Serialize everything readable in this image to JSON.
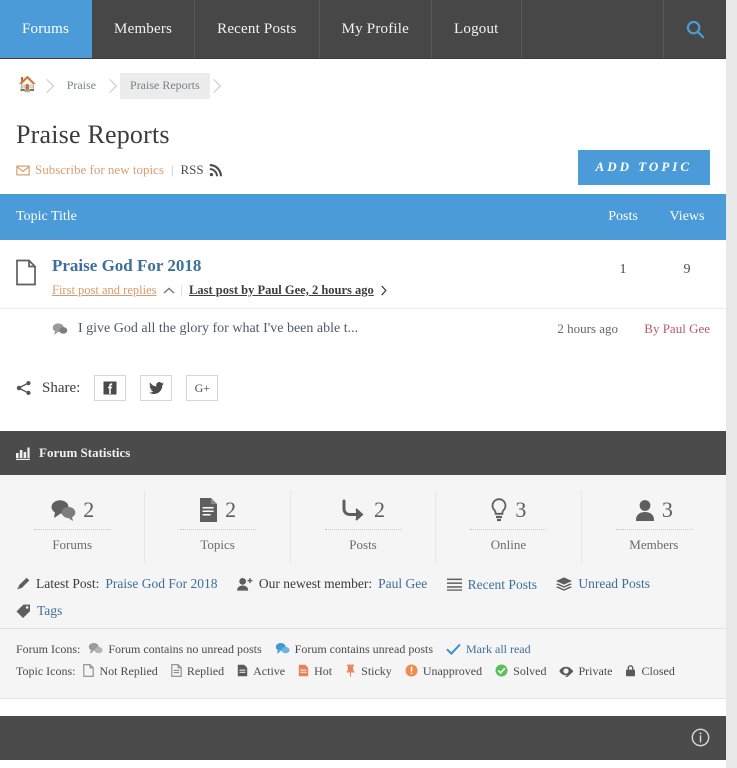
{
  "nav": {
    "items": [
      {
        "label": "Forums",
        "active": true
      },
      {
        "label": "Members",
        "active": false
      },
      {
        "label": "Recent Posts",
        "active": false
      },
      {
        "label": "My Profile",
        "active": false
      },
      {
        "label": "Logout",
        "active": false
      }
    ],
    "search_icon": "search-icon",
    "active_color": "#4a9bd8",
    "bar_color": "#474747"
  },
  "breadcrumb": {
    "home_icon": "home-icon",
    "items": [
      {
        "label": "Praise",
        "current": false
      },
      {
        "label": "Praise Reports",
        "current": true
      }
    ]
  },
  "header": {
    "title": "Praise Reports",
    "subscribe_label": "Subscribe for new topics",
    "separator": "|",
    "rss_label": "RSS",
    "add_topic_label": "ADD TOPIC"
  },
  "topic_table": {
    "columns": {
      "title": "Topic Title",
      "posts": "Posts",
      "views": "Views"
    },
    "rows": [
      {
        "icon": "document-icon",
        "title": "Praise God For 2018",
        "first_post_label": "First post and replies",
        "last_post_label": "Last post by Paul Gee, 2 hours ago",
        "posts": "1",
        "views": "9"
      }
    ],
    "replies": [
      {
        "icon": "comment-icon",
        "text": "I give God all the glory for what I've been able t...",
        "time": "2 hours ago",
        "author": "By Paul Gee"
      }
    ]
  },
  "share": {
    "label": "Share:",
    "icon": "share-icon",
    "buttons": [
      {
        "name": "facebook-icon",
        "label": "f"
      },
      {
        "name": "twitter-icon",
        "label": "t"
      },
      {
        "name": "google-plus-icon",
        "label": "G+"
      }
    ]
  },
  "statistics": {
    "heading": "Forum Statistics",
    "heading_icon": "chart-bar-icon",
    "cells": [
      {
        "icon": "comments-icon",
        "value": "2",
        "label": "Forums"
      },
      {
        "icon": "file-text-icon",
        "value": "2",
        "label": "Topics"
      },
      {
        "icon": "reply-arrow-icon",
        "value": "2",
        "label": "Posts"
      },
      {
        "icon": "lightbulb-icon",
        "value": "3",
        "label": "Online"
      },
      {
        "icon": "user-icon",
        "value": "3",
        "label": "Members"
      }
    ],
    "links": [
      {
        "icon": "pencil-icon",
        "prefix": "Latest Post:",
        "link": "Praise God For 2018"
      },
      {
        "icon": "user-plus-icon",
        "prefix": "Our newest member:",
        "link": "Paul Gee"
      },
      {
        "icon": "list-icon",
        "prefix": "",
        "link": "Recent Posts"
      },
      {
        "icon": "layers-icon",
        "prefix": "",
        "link": "Unread Posts"
      },
      {
        "icon": "tag-icon",
        "prefix": "",
        "link": "Tags"
      }
    ]
  },
  "legend": {
    "forum_icons_label": "Forum Icons:",
    "forum_items": [
      {
        "icon": "comments-gray-icon",
        "label": "Forum contains no unread posts",
        "color": "#9a9a9a"
      },
      {
        "icon": "comments-blue-icon",
        "label": "Forum contains unread posts",
        "color": "#3f9ad6"
      }
    ],
    "mark_all_read": "Mark all read",
    "mark_all_read_icon": "check-icon",
    "topic_icons_label": "Topic Icons:",
    "topic_items": [
      {
        "icon": "file-blank-icon",
        "label": "Not Replied",
        "color": "#8b8b8b"
      },
      {
        "icon": "file-lines-icon",
        "label": "Replied",
        "color": "#8b8b8b"
      },
      {
        "icon": "file-active-icon",
        "label": "Active",
        "color": "#5a5a5a"
      },
      {
        "icon": "file-hot-icon",
        "label": "Hot",
        "color": "#e8825a"
      },
      {
        "icon": "pin-icon",
        "label": "Sticky",
        "color": "#e8825a"
      },
      {
        "icon": "exclamation-circle-icon",
        "label": "Unapproved",
        "color": "#ef8b4f"
      },
      {
        "icon": "check-circle-icon",
        "label": "Solved",
        "color": "#5bbf5b"
      },
      {
        "icon": "eye-slash-icon",
        "label": "Private",
        "color": "#5a5a5a"
      },
      {
        "icon": "lock-icon",
        "label": "Closed",
        "color": "#5a5a5a"
      }
    ]
  },
  "bottom_bar": {
    "info_icon": "info-circle-icon"
  }
}
